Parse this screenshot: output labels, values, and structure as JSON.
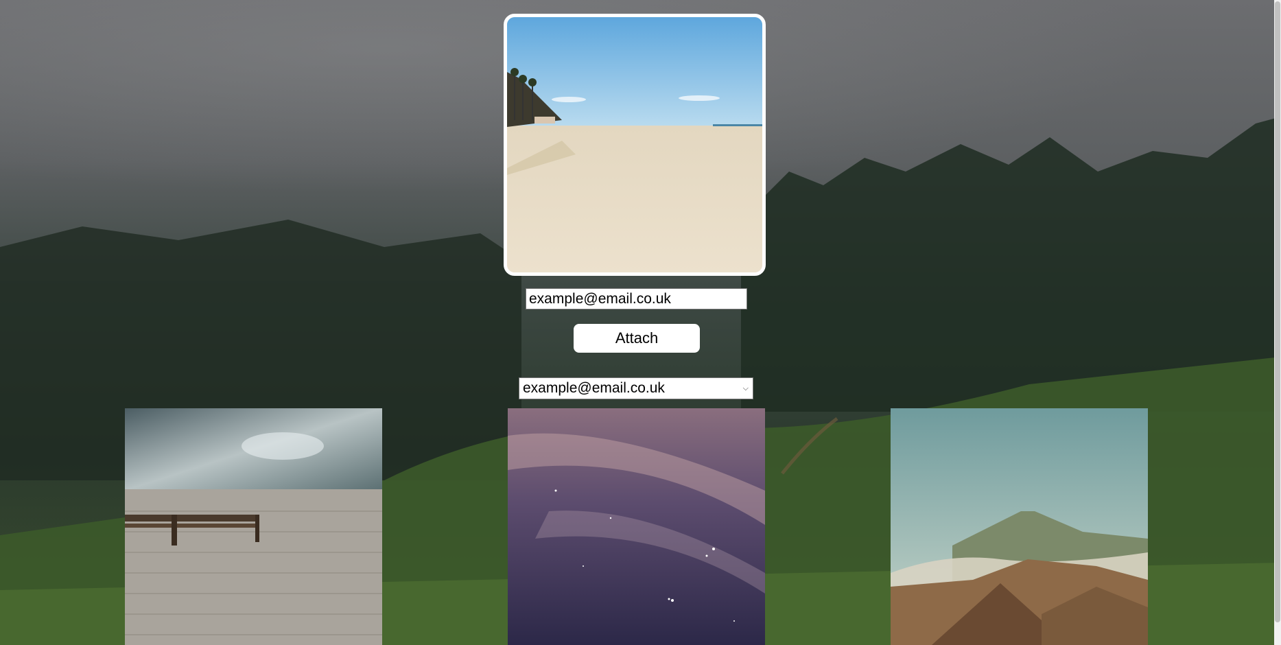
{
  "email_input": {
    "value": "example@email.co.uk"
  },
  "attach_button": {
    "label": "Attach"
  },
  "email_select": {
    "selected": "example@email.co.uk"
  },
  "images": {
    "hero": "beach-photo",
    "thumbnails": [
      "dock-bench-lake-photo",
      "night-sky-stars-photo",
      "volcano-landscape-photo"
    ]
  },
  "background": "foggy-forest-hills-photo",
  "colors": {
    "frame_border": "#ffffff",
    "button_bg": "#ffffff"
  }
}
